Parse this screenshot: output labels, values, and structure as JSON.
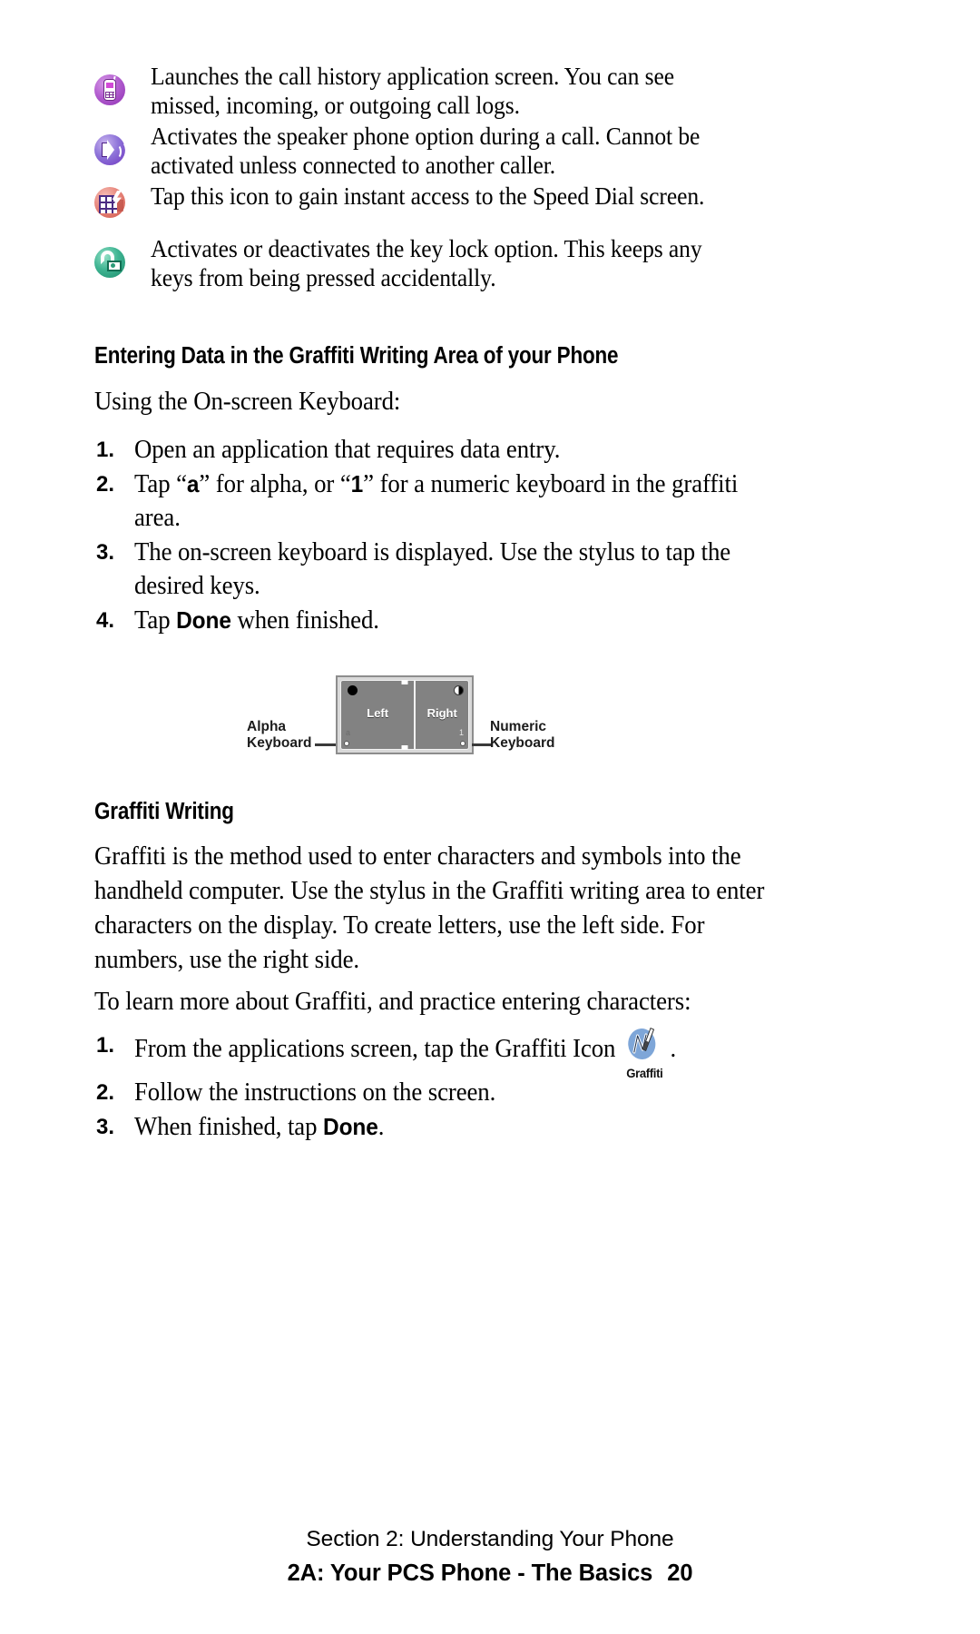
{
  "icon_descriptions": [
    {
      "icon": "call-history-icon",
      "text": "Launches the call history application screen. You can see missed, incoming, or outgoing call logs."
    },
    {
      "icon": "speaker-phone-icon",
      "text": "Activates the speaker phone option during a call. Cannot be activated unless connected to another caller."
    },
    {
      "icon": "speed-dial-icon",
      "text": "Tap this icon to gain instant access to the Speed Dial screen."
    },
    {
      "icon": "key-lock-icon",
      "text": "Activates or deactivates the key lock option. This keeps any keys from being pressed accidentally."
    }
  ],
  "section_entering_data": {
    "heading": "Entering Data in the Graffiti Writing Area of your Phone",
    "intro": "Using the On-screen Keyboard:",
    "steps": [
      {
        "num": "1.",
        "text": "Open an application that requires data entry."
      },
      {
        "num": "2.",
        "text_pre": "Tap “",
        "bold1": "a",
        "text_mid": "” for alpha, or “",
        "bold2": "1",
        "text_post": "” for a numeric keyboard in the graffiti area."
      },
      {
        "num": "3.",
        "text": "The on-screen keyboard is displayed. Use the stylus to tap the desired keys."
      },
      {
        "num": "4.",
        "text_pre": "Tap ",
        "bold1": "Done",
        "text_post": " when finished."
      }
    ]
  },
  "figure": {
    "name": "graffiti-writing-area-diagram",
    "label_left_line1": "Alpha",
    "label_left_line2": "Keyboard",
    "label_right_line1": "Numeric",
    "label_right_line2": "Keyboard",
    "left_region": "Left",
    "right_region": "Right",
    "mini_left": "a",
    "mini_right": "1"
  },
  "section_graffiti_writing": {
    "heading": "Graffiti Writing",
    "paragraph": "Graffiti is the method used to enter characters and symbols into the handheld computer. Use the stylus in the Graffiti writing area to enter characters on the display. To create letters, use the left side. For numbers, use the right side.",
    "intro": "To learn more about Graffiti, and practice entering characters:",
    "steps": [
      {
        "num": "1.",
        "text_pre": "From the applications screen, tap the Graffiti Icon",
        "icon_label": "Graffiti",
        "text_post": "."
      },
      {
        "num": "2.",
        "text": "Follow the instructions on the screen."
      },
      {
        "num": "3.",
        "text_pre": "When finished, tap ",
        "bold1": "Done",
        "text_post": "."
      }
    ]
  },
  "footer": {
    "section_line": "Section 2: Understanding Your Phone",
    "chapter_line": "2A: Your PCS Phone - The Basics",
    "page_number": "20"
  }
}
